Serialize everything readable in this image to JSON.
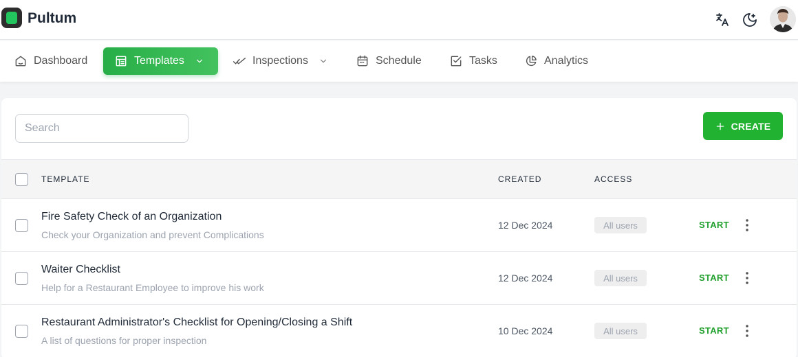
{
  "app": {
    "name": "Pultum"
  },
  "nav": {
    "items": [
      {
        "label": "Dashboard"
      },
      {
        "label": "Templates"
      },
      {
        "label": "Inspections"
      },
      {
        "label": "Schedule"
      },
      {
        "label": "Tasks"
      },
      {
        "label": "Analytics"
      }
    ]
  },
  "search": {
    "placeholder": "Search"
  },
  "toolbar": {
    "create_label": "CREATE"
  },
  "table": {
    "headers": {
      "template": "TEMPLATE",
      "created": "CREATED",
      "access": "ACCESS"
    },
    "rows": [
      {
        "title": "Fire Safety Check of an Organization",
        "description": "Check your Organization and prevent Complications",
        "created": "12 Dec 2024",
        "access": "All users",
        "action": "START"
      },
      {
        "title": "Waiter Checklist",
        "description": "Help for a Restaurant Employee to improve his work",
        "created": "12 Dec 2024",
        "access": "All users",
        "action": "START"
      },
      {
        "title": "Restaurant Administrator's Checklist for Opening/Closing a Shift",
        "description": "A list of questions for proper inspection",
        "created": "10 Dec 2024",
        "access": "All users",
        "action": "START"
      }
    ]
  },
  "colors": {
    "accent": "#22b232",
    "active_nav": "#27ae47",
    "start_text": "#22a02e"
  },
  "icons": [
    "translate-icon",
    "moon-icon",
    "home-icon",
    "layout-icon",
    "chevron-down-icon",
    "double-check-icon",
    "calendar-icon",
    "checkbox-icon",
    "pie-chart-icon",
    "plus-icon",
    "more-vertical-icon"
  ]
}
